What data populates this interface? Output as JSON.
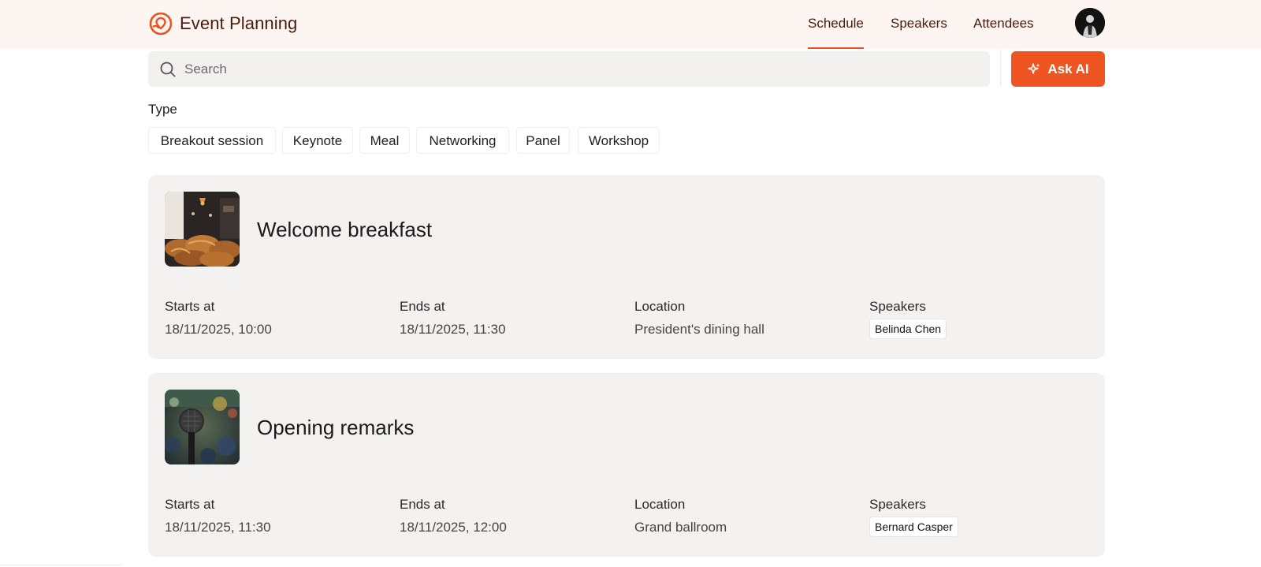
{
  "app": {
    "title": "Event Planning",
    "accent_color": "#ee5520"
  },
  "nav": {
    "items": [
      {
        "label": "Schedule",
        "active": true
      },
      {
        "label": "Speakers",
        "active": false
      },
      {
        "label": "Attendees",
        "active": false
      }
    ]
  },
  "search": {
    "placeholder": "Search",
    "value": ""
  },
  "ask_ai": {
    "label": "Ask AI",
    "icon": "sparkle-icon"
  },
  "filters": {
    "label": "Type",
    "chips": [
      "Breakout session",
      "Keynote",
      "Meal",
      "Networking",
      "Panel",
      "Workshop"
    ]
  },
  "sessions": [
    {
      "title": "Welcome breakfast",
      "image": "breakfast-pastries-photo",
      "starts_label": "Starts at",
      "starts": "18/11/2025, 10:00",
      "ends_label": "Ends at",
      "ends": "18/11/2025, 11:30",
      "location_label": "Location",
      "location": "President's dining hall",
      "speakers_label": "Speakers",
      "speakers": [
        "Belinda Chen"
      ]
    },
    {
      "title": "Opening remarks",
      "image": "microphone-stage-photo",
      "starts_label": "Starts at",
      "starts": "18/11/2025, 11:30",
      "ends_label": "Ends at",
      "ends": "18/11/2025, 12:00",
      "location_label": "Location",
      "location": "Grand ballroom",
      "speakers_label": "Speakers",
      "speakers": [
        "Bernard Casper"
      ]
    }
  ]
}
